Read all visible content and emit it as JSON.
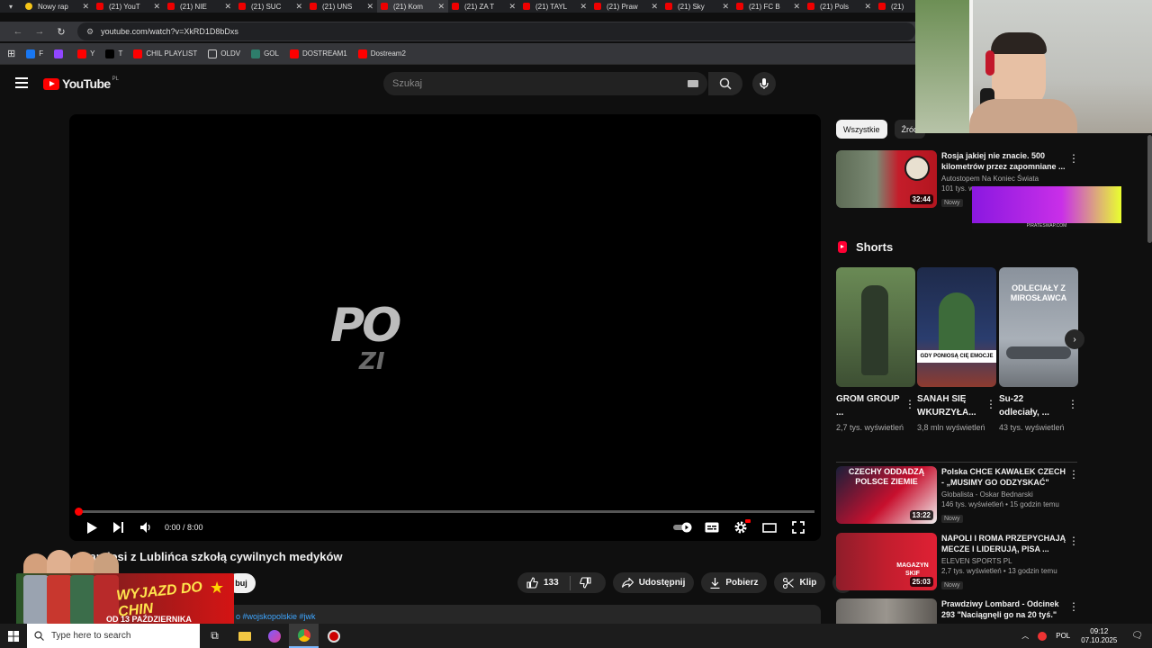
{
  "browser": {
    "tabs": [
      {
        "title": "Nowy rap",
        "active": false,
        "icon": "yellow"
      },
      {
        "title": "(21) YouT",
        "active": false
      },
      {
        "title": "(21) NIE",
        "active": false
      },
      {
        "title": "(21) SUC",
        "active": false
      },
      {
        "title": "(21) UNS",
        "active": false
      },
      {
        "title": "(21) Kom",
        "active": true
      },
      {
        "title": "(21) ZA T",
        "active": false
      },
      {
        "title": "(21) TAYL",
        "active": false
      },
      {
        "title": "(21) Praw",
        "active": false
      },
      {
        "title": "(21) Sky",
        "active": false
      },
      {
        "title": "(21) FC B",
        "active": false
      },
      {
        "title": "(21) Pols",
        "active": false
      },
      {
        "title": "(21)",
        "active": false
      }
    ],
    "url": "youtube.com/watch?v=XkRD1D8bDxs",
    "bookmarks": [
      {
        "label": "F",
        "color": "#1877f2"
      },
      {
        "label": "",
        "color": "#9146ff"
      },
      {
        "label": "Y",
        "color": "#ff0000"
      },
      {
        "label": "T",
        "color": "#000000"
      },
      {
        "label": "CHIL PLAYLIST",
        "color": "#ff0000"
      },
      {
        "label": "OLDV",
        "color": "folder"
      },
      {
        "label": "GOL",
        "color": "#2e7d6b"
      },
      {
        "label": "DOSTREAM1",
        "color": "#ff0000"
      },
      {
        "label": "Dostream2",
        "color": "#ff0000"
      }
    ]
  },
  "youtube": {
    "logo_text": "YouTube",
    "logo_country": "PL",
    "search_placeholder": "Szukaj",
    "player": {
      "watermark": "PO",
      "watermark2": "ZI",
      "time": "0:00 / 8:00",
      "progress": 0.0
    },
    "video_title": "omandosi z Lublińca szkołą cywilnych medyków",
    "subscribe_partial": "buj",
    "actions": {
      "likes": "133",
      "share": "Udostępnij",
      "download": "Pobierz",
      "clip": "Klip"
    },
    "description_tags": "o #wojskopolskie #jwk",
    "promo": {
      "title": "WYJAZD DO CHIN",
      "date": "OD 13 PAŹDZIERNIKA"
    },
    "chips": [
      "Wszystkie",
      "Źród"
    ],
    "recs_top": [
      {
        "title": "Rosja jakiej nie znacie. 500 kilometrów przez zapomniane ...",
        "channel": "Autostopem Na Koniec Świata",
        "meta": "101 tys. w",
        "badge": "Nowy",
        "duration": "32:44"
      }
    ],
    "shorts_title": "Shorts",
    "shorts": [
      {
        "title": "GROM GROUP ...",
        "views": "2,7 tys. wyświetleń",
        "thumb_text": ""
      },
      {
        "title": "SANAH SIĘ WKURZYŁA...",
        "views": "3,8 mln wyświetleń",
        "thumb_text": "GDY PONIOSĄ CIĘ EMOCJE"
      },
      {
        "title": "Su-22 odleciały, ...",
        "views": "43 tys. wyświetleń",
        "thumb_text": "ODLECIAŁY Z MIROSŁAWCA"
      }
    ],
    "recs_bottom": [
      {
        "title": "Polska CHCE KAWAŁEK CZECH - „MUSIMY GO ODZYSKAĆ\"",
        "channel": "Globalista - Oskar Bednarski",
        "meta": "146 tys. wyświetleń • 15 godzin temu",
        "badge": "Nowy",
        "duration": "13:22",
        "thumb_text": "CZECHY ODDADZĄ POLSCE ZIEMIE"
      },
      {
        "title": "NAPOLI I ROMA PRZEPYCHAJĄ MECZE I LIDERUJĄ, PISA ...",
        "channel": "ELEVEN SPORTS PL",
        "meta": "2,7 tys. wyświetleń • 13 godzin temu",
        "badge": "Nowy",
        "duration": "25:03",
        "thumb_text": "MAGAZYN SKIF"
      },
      {
        "title": "Prawdziwy Lombard - Odcinek 293 \"Naciągnęli go na 20 tyś.\"",
        "channel": "",
        "meta": "",
        "badge": "",
        "duration": "",
        "thumb_text": ""
      }
    ]
  },
  "overlay_ad_caption": "PIRATESWAP.COM",
  "taskbar": {
    "search_placeholder": "Type here to search",
    "language": "POL",
    "time": "09:12",
    "date": "07.10.2025"
  }
}
